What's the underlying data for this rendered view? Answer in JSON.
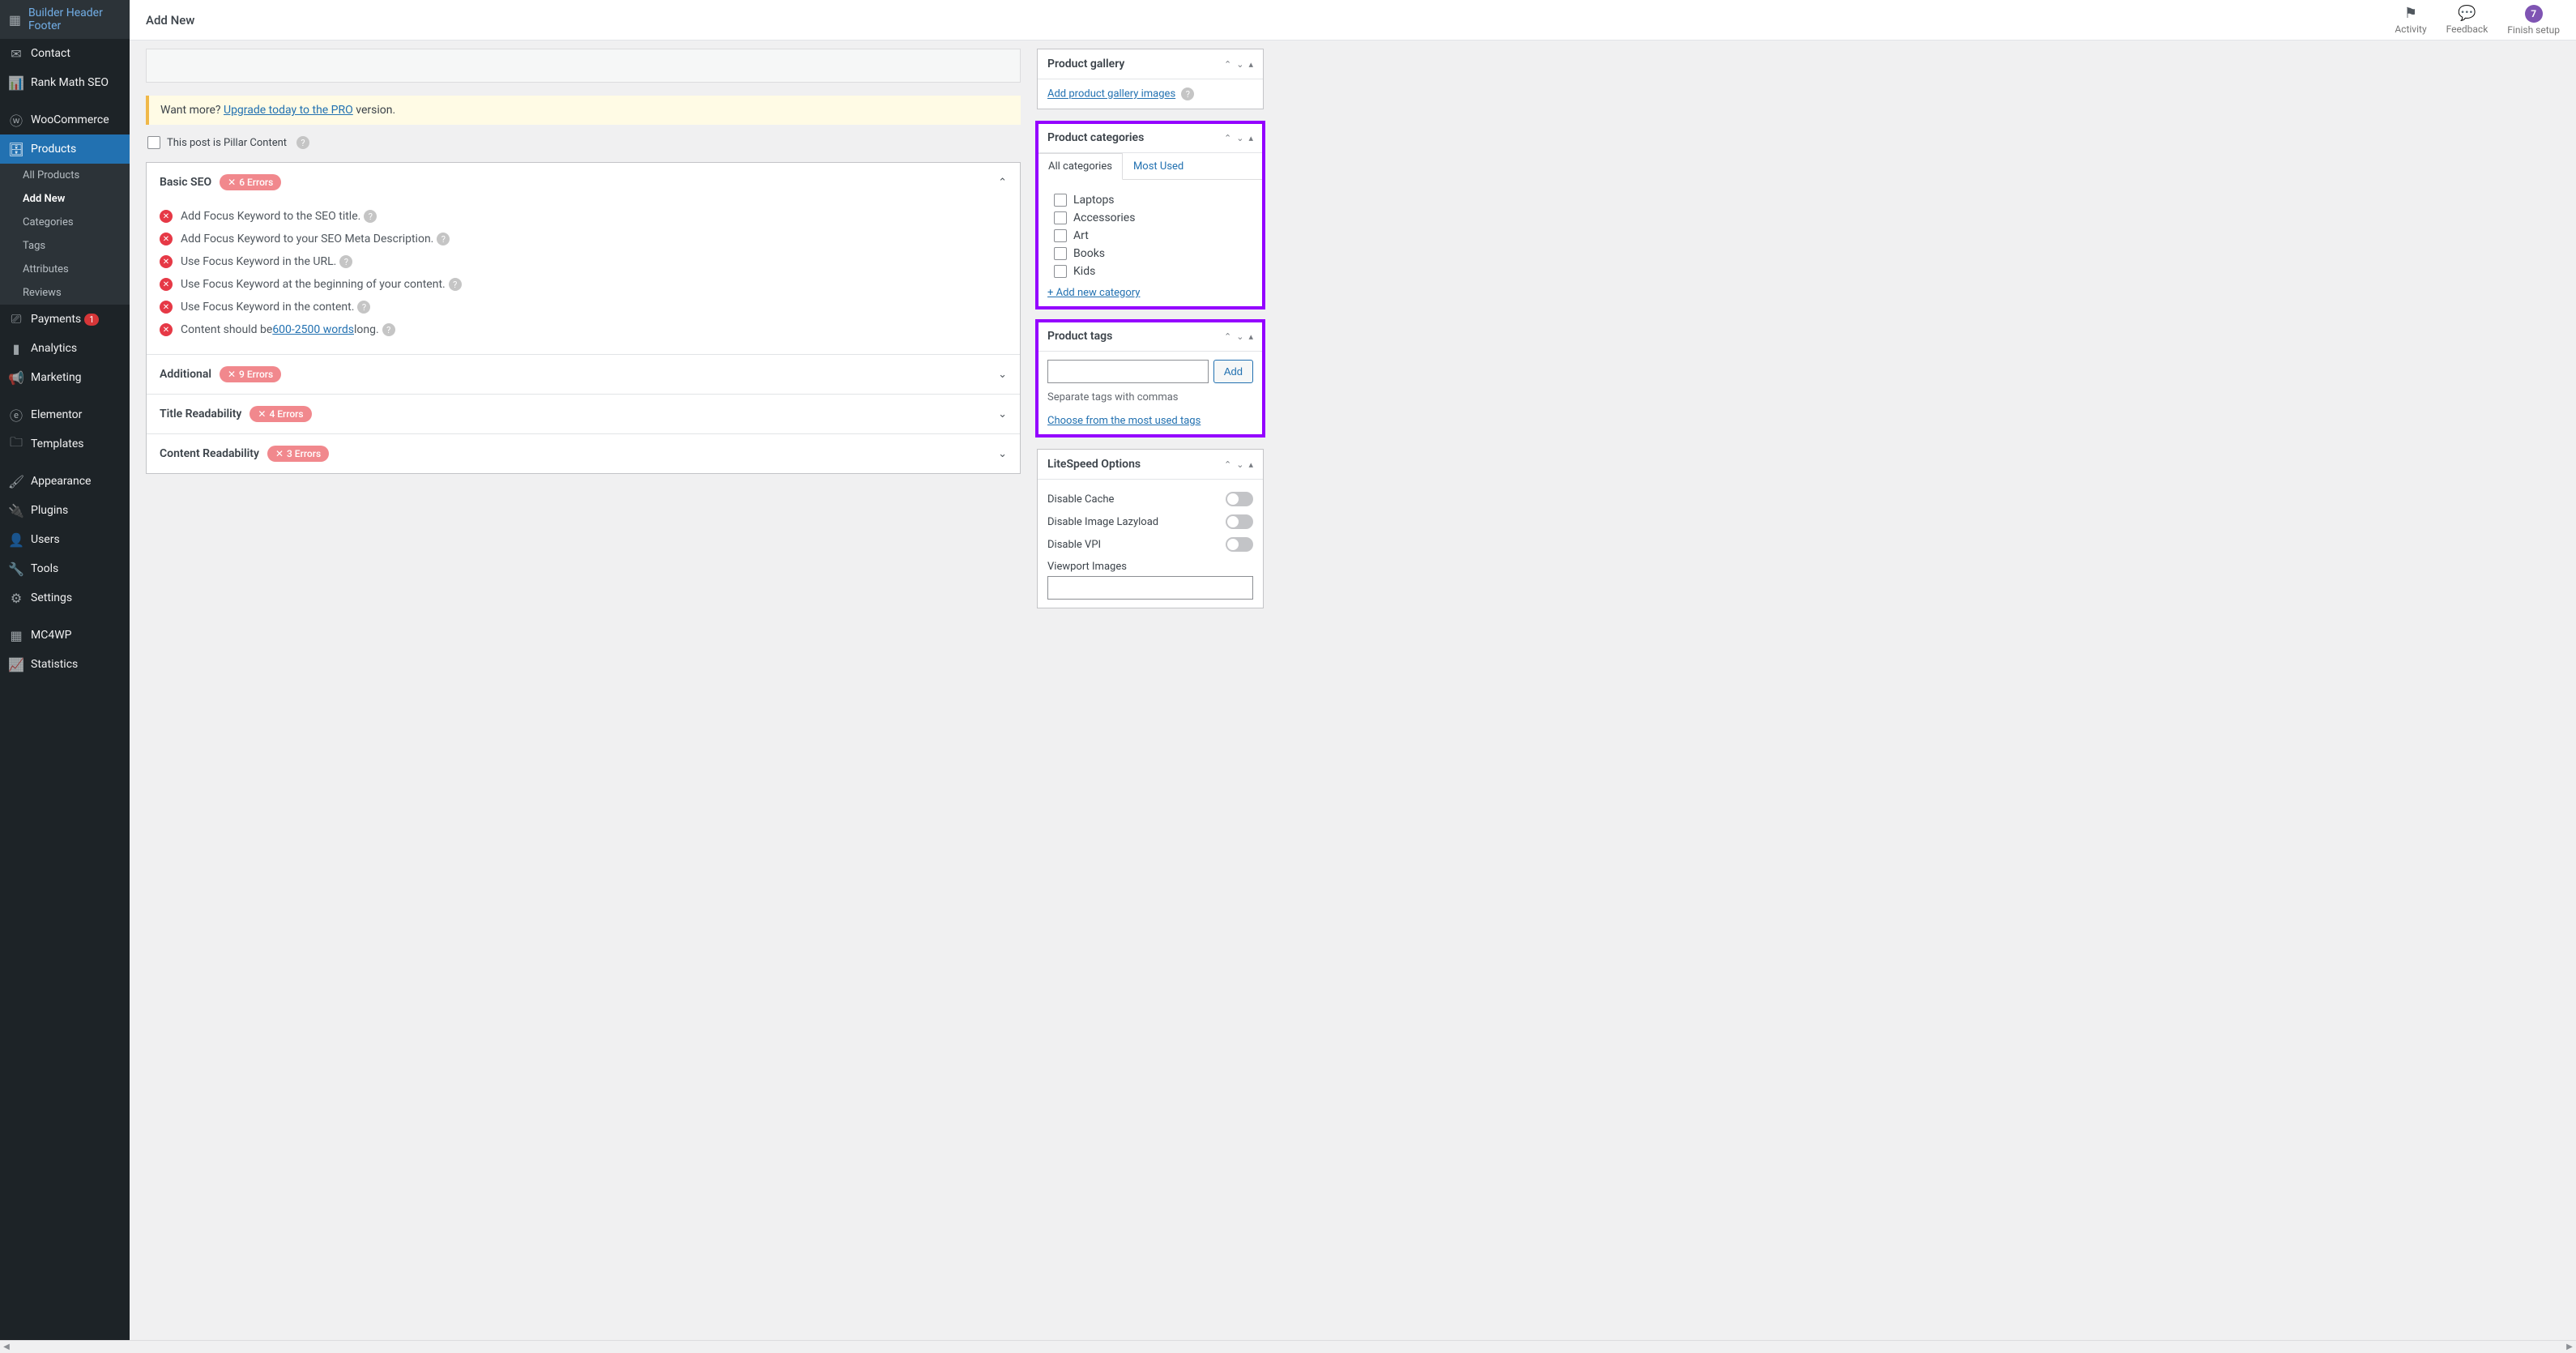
{
  "topbar": {
    "title": "Add New",
    "activity": "Activity",
    "feedback": "Feedback",
    "finish": "Finish setup",
    "finish_badge": "7"
  },
  "sidebar": {
    "builder_header_footer": "Builder Header Footer",
    "contact": "Contact",
    "rankmath": "Rank Math SEO",
    "woocommerce": "WooCommerce",
    "products": "Products",
    "submenu": {
      "all_products": "All Products",
      "add_new": "Add New",
      "categories": "Categories",
      "tags": "Tags",
      "attributes": "Attributes",
      "reviews": "Reviews"
    },
    "payments": "Payments",
    "payments_badge": "1",
    "analytics": "Analytics",
    "marketing": "Marketing",
    "elementor": "Elementor",
    "templates": "Templates",
    "appearance": "Appearance",
    "plugins": "Plugins",
    "users": "Users",
    "tools": "Tools",
    "settings": "Settings",
    "mc4wp": "MC4WP",
    "statistics": "Statistics"
  },
  "promo": {
    "want_more": "Want more? ",
    "upgrade_link": "Upgrade today to the PRO",
    "version": " version."
  },
  "pillar": {
    "label": "This post is Pillar Content"
  },
  "seo": {
    "basic_title": "Basic SEO",
    "basic_errors": "6 Errors",
    "additional_title": "Additional",
    "additional_errors": "9 Errors",
    "title_read_title": "Title Readability",
    "title_read_errors": "4 Errors",
    "content_read_title": "Content Readability",
    "content_read_errors": "3 Errors",
    "items": {
      "i1": "Add Focus Keyword to the SEO title.",
      "i2": "Add Focus Keyword to your SEO Meta Description.",
      "i3": "Use Focus Keyword in the URL.",
      "i4": "Use Focus Keyword at the beginning of your content.",
      "i5": "Use Focus Keyword in the content.",
      "i6_pre": "Content should be ",
      "i6_link": "600-2500 words",
      "i6_post": " long."
    }
  },
  "gallery": {
    "title": "Product gallery",
    "add_link": "Add product gallery images"
  },
  "categories": {
    "title": "Product categories",
    "tab_all": "All categories",
    "tab_used": "Most Used",
    "items": {
      "c1": "Laptops",
      "c2": "Accessories",
      "c3": "Art",
      "c4": "Books",
      "c5": "Kids"
    },
    "add_new": "+ Add new category"
  },
  "tags": {
    "title": "Product tags",
    "add_btn": "Add",
    "hint": "Separate tags with commas",
    "choose_link": "Choose from the most used tags"
  },
  "litespeed": {
    "title": "LiteSpeed Options",
    "disable_cache": "Disable Cache",
    "disable_lazy": "Disable Image Lazyload",
    "disable_vpi": "Disable VPI",
    "viewport": "Viewport Images"
  }
}
